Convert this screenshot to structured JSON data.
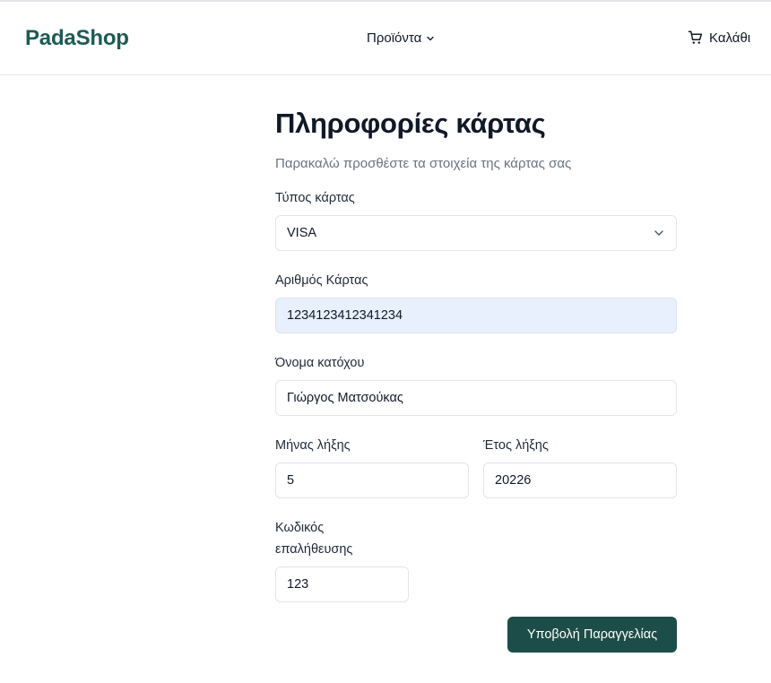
{
  "header": {
    "logo": "PadaShop",
    "nav_products": "Προϊόντα",
    "nav_cart": "Καλάθι"
  },
  "form": {
    "title": "Πληροφορίες κάρτας",
    "subtitle": "Παρακαλώ προσθέστε τα στοιχεία της κάρτας σας",
    "card_type": {
      "label": "Τύπος κάρτας",
      "value": "VISA"
    },
    "card_number": {
      "label": "Αριθμός Κάρτας",
      "value": "1234123412341234"
    },
    "holder_name": {
      "label": "Όνομα κατόχου",
      "value": "Γιώργος Ματσούκας"
    },
    "exp_month": {
      "label": "Μήνας λήξης",
      "value": "5"
    },
    "exp_year": {
      "label": "Έτος λήξης",
      "value": "20226"
    },
    "cvv": {
      "label_line1": "Κωδικός",
      "label_line2": "επαλήθευσης",
      "value": "123"
    },
    "submit_label": "Υποβολή Παραγγελίας"
  },
  "colors": {
    "brand": "#1d5b54",
    "button": "#1d4d48",
    "autofill": "#e8f0fe",
    "muted": "#6b7280"
  },
  "icons": {
    "products": "chevron-down-icon",
    "cart": "cart-icon",
    "select": "chevron-down-icon"
  }
}
